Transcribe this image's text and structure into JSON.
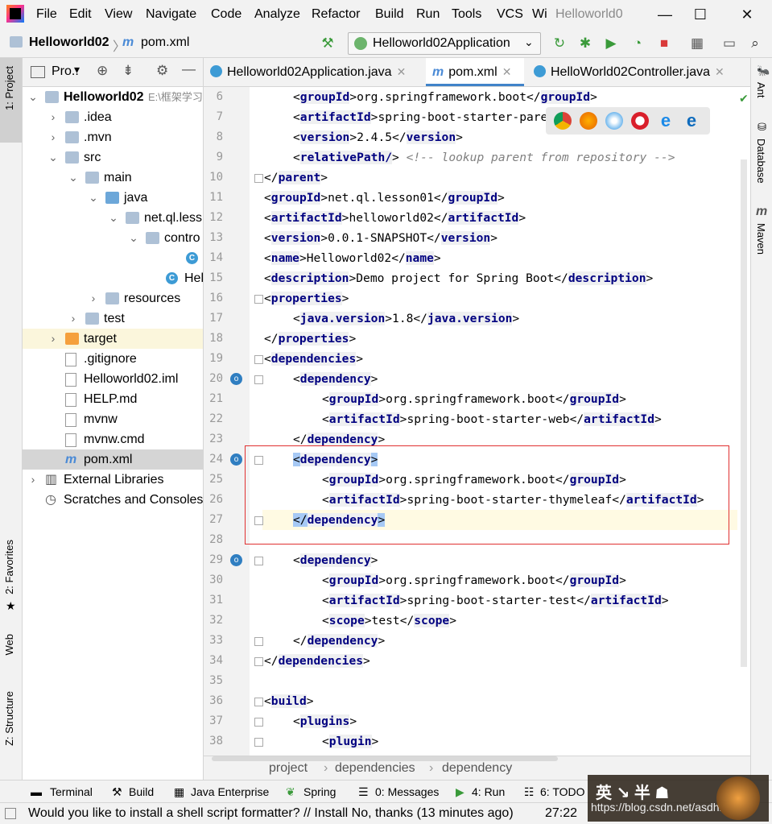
{
  "menubar": {
    "items": [
      "File",
      "Edit",
      "View",
      "Navigate",
      "Code",
      "Analyze",
      "Refactor",
      "Build",
      "Run",
      "Tools",
      "VCS",
      "Wi"
    ],
    "window_title": "Helloworld0"
  },
  "navbar": {
    "project": "Helloworld02",
    "file": "pom.xml",
    "run_config": "Helloworld02Application"
  },
  "left_stripe": {
    "project": "1: Project",
    "favorites": "2: Favorites",
    "web": "Web",
    "structure": "Z: Structure"
  },
  "right_stripe": {
    "ant": "Ant",
    "database": "Database",
    "maven": "Maven"
  },
  "project_panel": {
    "header": "Pro..",
    "tree": [
      {
        "label": "Helloworld02",
        "extra": "E:\\框架学习",
        "bold": true
      },
      {
        "label": ".idea"
      },
      {
        "label": ".mvn"
      },
      {
        "label": "src"
      },
      {
        "label": "main"
      },
      {
        "label": "java"
      },
      {
        "label": "net.ql.less"
      },
      {
        "label": "contro"
      },
      {
        "label": "Hel"
      },
      {
        "label": "Hellow"
      },
      {
        "label": "resources"
      },
      {
        "label": "test"
      },
      {
        "label": "target"
      },
      {
        "label": ".gitignore"
      },
      {
        "label": "Helloworld02.iml"
      },
      {
        "label": "HELP.md"
      },
      {
        "label": "mvnw"
      },
      {
        "label": "mvnw.cmd"
      },
      {
        "label": "pom.xml"
      },
      {
        "label": "External Libraries"
      },
      {
        "label": "Scratches and Consoles"
      }
    ]
  },
  "editor_tabs": [
    {
      "label": "Helloworld02Application.java"
    },
    {
      "label": "pom.xml"
    },
    {
      "label": "HelloWorld02Controller.java"
    }
  ],
  "editor": {
    "line_numbers": [
      "6",
      "7",
      "8",
      "9",
      "10",
      "11",
      "12",
      "13",
      "14",
      "15",
      "16",
      "17",
      "18",
      "19",
      "20",
      "21",
      "22",
      "23",
      "24",
      "25",
      "26",
      "27",
      "28",
      "29",
      "30",
      "31",
      "32",
      "33",
      "34",
      "35",
      "36",
      "37",
      "38"
    ],
    "lines": [
      {
        "indent": 1,
        "tag": "groupId",
        "text": "org.springframework.boot"
      },
      {
        "indent": 1,
        "tag": "artifactId",
        "text": "spring-boot-starter-paren"
      },
      {
        "indent": 1,
        "tag": "version",
        "text": "2.4.5"
      },
      {
        "indent": 1,
        "raw_open": "relativePath/",
        "comment": "<!-- lookup parent from repository -->"
      },
      {
        "indent": 0,
        "close": "parent"
      },
      {
        "indent": 0,
        "tag": "groupId",
        "text": "net.ql.lesson01"
      },
      {
        "indent": 0,
        "tag": "artifactId",
        "text": "helloworld02"
      },
      {
        "indent": 0,
        "tag": "version",
        "text": "0.0.1-SNAPSHOT"
      },
      {
        "indent": 0,
        "tag": "name",
        "text": "Helloworld02"
      },
      {
        "indent": 0,
        "tag": "description",
        "text": "Demo project for Spring Boot"
      },
      {
        "indent": 0,
        "open": "properties"
      },
      {
        "indent": 1,
        "tag": "java.version",
        "text": "1.8"
      },
      {
        "indent": 0,
        "close": "properties"
      },
      {
        "indent": 0,
        "open": "dependencies"
      },
      {
        "indent": 1,
        "open": "dependency"
      },
      {
        "indent": 2,
        "tag": "groupId",
        "text": "org.springframework.boot"
      },
      {
        "indent": 2,
        "tag": "artifactId",
        "text": "spring-boot-starter-web"
      },
      {
        "indent": 1,
        "close": "dependency"
      },
      {
        "indent": 1,
        "open": "dependency",
        "hl": true
      },
      {
        "indent": 2,
        "tag": "groupId",
        "text": "org.springframework.boot"
      },
      {
        "indent": 2,
        "tag": "artifactId",
        "text": "spring-boot-starter-thymeleaf"
      },
      {
        "indent": 1,
        "close": "dependency",
        "hl": true
      },
      {
        "indent": 0
      },
      {
        "indent": 1,
        "open": "dependency"
      },
      {
        "indent": 2,
        "tag": "groupId",
        "text": "org.springframework.boot"
      },
      {
        "indent": 2,
        "tag": "artifactId",
        "text": "spring-boot-starter-test"
      },
      {
        "indent": 2,
        "tag": "scope",
        "text": "test"
      },
      {
        "indent": 1,
        "close": "dependency"
      },
      {
        "indent": 0,
        "close": "dependencies"
      },
      {
        "indent": 0
      },
      {
        "indent": 0,
        "open": "build"
      },
      {
        "indent": 1,
        "open": "plugins"
      },
      {
        "indent": 2,
        "open": "plugin"
      }
    ]
  },
  "breadcrumbs": [
    "project",
    "dependencies",
    "dependency"
  ],
  "bottom_tabs": [
    "Terminal",
    "Build",
    "Java Enterprise",
    "Spring",
    "0: Messages",
    "4: Run",
    "6: TODO"
  ],
  "status": {
    "message": "Would you like to install a shell script formatter? // Install   No, thanks (13 minutes ago)",
    "position": "27:22"
  },
  "watermark": {
    "text": "英 ↘ 半 ☗",
    "url": "https://blog.csdn.net/asdhkjdk"
  },
  "colors": {
    "tag": "#000080",
    "accent": "#4083c9",
    "selection": "#a6c9f5",
    "annotation_box": "#e03030"
  }
}
